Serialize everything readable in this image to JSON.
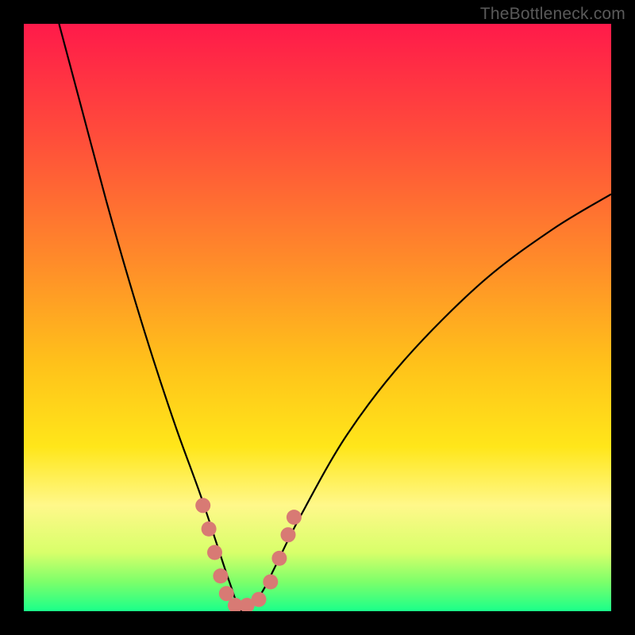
{
  "watermark": "TheBottleneck.com",
  "chart_data": {
    "type": "line",
    "title": "",
    "xlabel": "",
    "ylabel": "",
    "xlim": [
      0,
      100
    ],
    "ylim": [
      0,
      100
    ],
    "grid": false,
    "background": {
      "type": "vertical-gradient",
      "description": "red-orange-yellow-green gradient where green (bottom) is optimal and red (top) is worst bottleneck",
      "stops": [
        {
          "pos": 0,
          "color": "#ff1a4a"
        },
        {
          "pos": 20,
          "color": "#ff4f3a"
        },
        {
          "pos": 40,
          "color": "#ff8a2a"
        },
        {
          "pos": 58,
          "color": "#ffc21a"
        },
        {
          "pos": 72,
          "color": "#ffe61a"
        },
        {
          "pos": 82,
          "color": "#fff88a"
        },
        {
          "pos": 90,
          "color": "#d8ff6a"
        },
        {
          "pos": 95,
          "color": "#7dff6a"
        },
        {
          "pos": 100,
          "color": "#1aff8a"
        }
      ]
    },
    "series": [
      {
        "name": "bottleneck-curve",
        "description": "V-shaped bottleneck curve; minimum around x≈37 at y≈0, left branch steep from top-left, right branch rises to about y≈71 at x=100",
        "color": "#000000",
        "x": [
          6,
          10,
          14,
          18,
          22,
          26,
          30,
          33,
          35,
          37,
          39,
          41,
          43,
          47,
          55,
          65,
          78,
          90,
          100
        ],
        "y": [
          100,
          85,
          70,
          56,
          43,
          31,
          20,
          11,
          5,
          0,
          1,
          4,
          8,
          16,
          30,
          43,
          56,
          65,
          71
        ]
      }
    ],
    "points": [
      {
        "name": "marker-dots",
        "description": "salmon-colored dots near bottom of V marking specific hardware points",
        "color": "#d87a74",
        "data": [
          {
            "x": 30.5,
            "y": 18
          },
          {
            "x": 31.5,
            "y": 14
          },
          {
            "x": 32.5,
            "y": 10
          },
          {
            "x": 33.5,
            "y": 6
          },
          {
            "x": 34.5,
            "y": 3
          },
          {
            "x": 36,
            "y": 1
          },
          {
            "x": 38,
            "y": 1
          },
          {
            "x": 40,
            "y": 2
          },
          {
            "x": 42,
            "y": 5
          },
          {
            "x": 43.5,
            "y": 9
          },
          {
            "x": 45,
            "y": 13
          },
          {
            "x": 46,
            "y": 16
          }
        ]
      }
    ]
  }
}
